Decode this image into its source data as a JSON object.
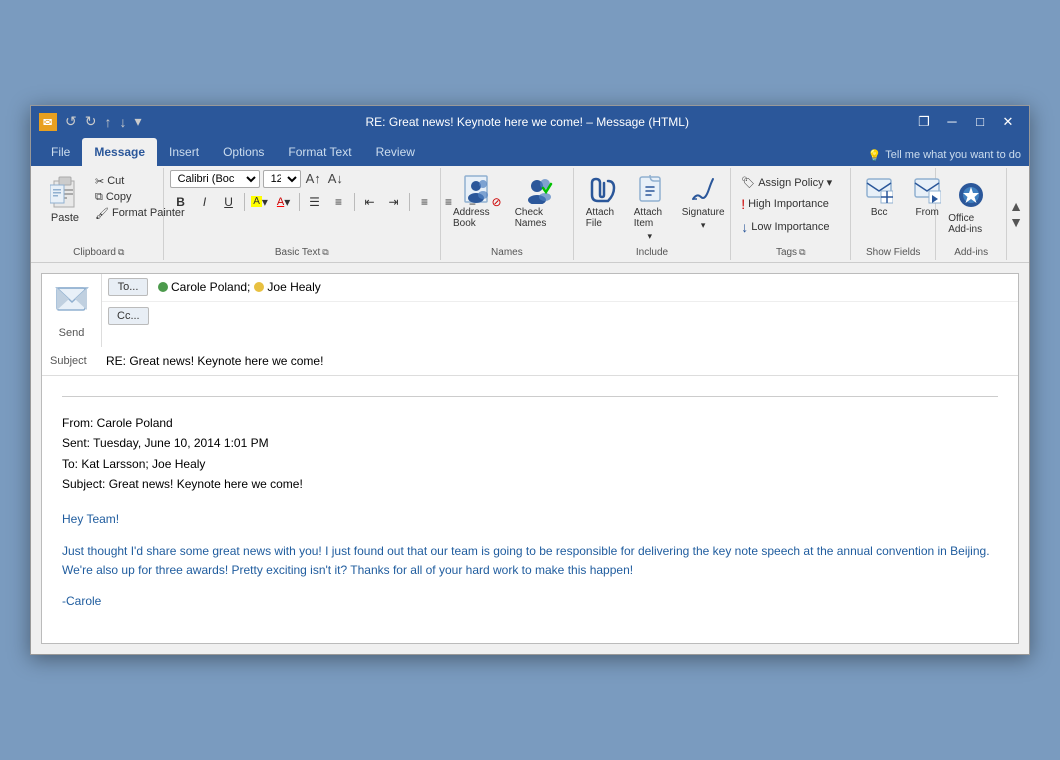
{
  "window": {
    "title": "RE: Great news! Keynote here we come! – Message (HTML)",
    "icon": "✉"
  },
  "titlebar": {
    "undo_label": "↺",
    "redo_label": "↻",
    "up_label": "↑",
    "down_label": "↓",
    "more_label": "▾"
  },
  "win_controls": {
    "restore": "❐",
    "minimize": "─",
    "maximize": "□",
    "close": "✕"
  },
  "tabs": [
    {
      "id": "file",
      "label": "File"
    },
    {
      "id": "message",
      "label": "Message",
      "active": true
    },
    {
      "id": "insert",
      "label": "Insert"
    },
    {
      "id": "options",
      "label": "Options"
    },
    {
      "id": "format-text",
      "label": "Format Text"
    },
    {
      "id": "review",
      "label": "Review"
    }
  ],
  "tell_me": {
    "icon": "💡",
    "placeholder": "Tell me what you want to do"
  },
  "ribbon": {
    "clipboard": {
      "label": "Clipboard",
      "paste_label": "Paste",
      "cut_label": "Cut",
      "copy_label": "Copy",
      "format_painter_label": "Format Painter"
    },
    "basic_text": {
      "label": "Basic Text",
      "font_name": "Calibri (Boc",
      "font_size": "12",
      "bold": "B",
      "italic": "I",
      "underline": "U"
    },
    "names": {
      "label": "Names",
      "address_book": "Address Book",
      "check_names": "Check Names"
    },
    "include": {
      "label": "Include",
      "attach_file": "Attach File",
      "attach_item": "Attach Item",
      "signature": "Signature"
    },
    "tags": {
      "label": "Tags",
      "assign_policy": "Assign Policy ▾",
      "high_importance": "High Importance",
      "low_importance": "Low Importance"
    },
    "show_fields": {
      "label": "Show Fields",
      "bcc": "Bcc",
      "from": "From"
    },
    "addins": {
      "label": "Add-ins",
      "office_addins": "Office Add-ins"
    }
  },
  "compose": {
    "to_label": "To...",
    "cc_label": "Cc...",
    "send_label": "Send",
    "recipients": [
      {
        "name": "Carole Poland",
        "color": "green"
      },
      {
        "name": "Joe Healy",
        "color": "yellow"
      }
    ],
    "subject_label": "Subject",
    "subject": "RE: Great news! Keynote here we come!"
  },
  "email": {
    "from": "From: Carole Poland",
    "sent": "Sent: Tuesday, June 10, 2014 1:01 PM",
    "to": "To: Kat Larsson; Joe Healy",
    "subject_line": "Subject: Great news! Keynote here we come!",
    "greeting": "Hey Team!",
    "body": "Just thought I'd share some great news with you! I just found out that our team is going to be responsible for delivering the key note speech at the annual convention in Beijing. We're also up for three awards! Pretty exciting isn't it? Thanks for all of your hard work to make this happen!",
    "signature": "-Carole"
  }
}
